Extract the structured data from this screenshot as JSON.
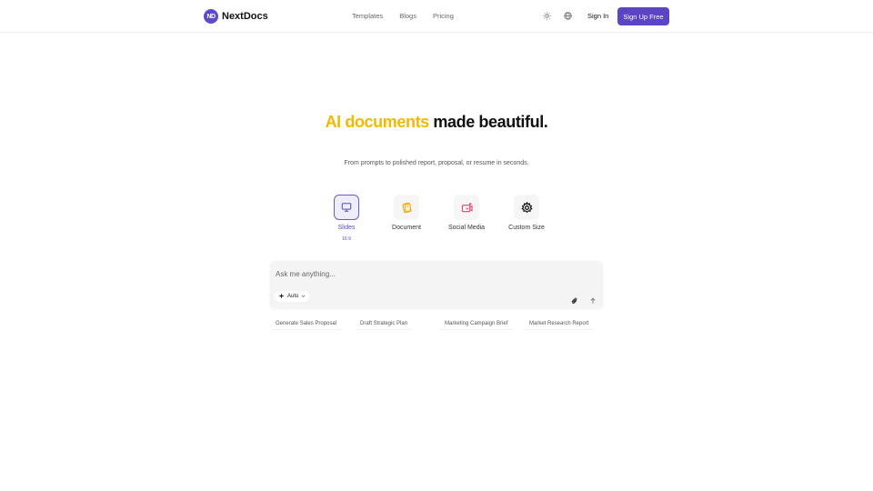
{
  "brand": {
    "mark": "ND",
    "name": "NextDocs",
    "accent": "#5a4bc9"
  },
  "nav": {
    "templates": "Templates",
    "blogs": "Blogs",
    "pricing": "Pricing"
  },
  "actions": {
    "theme_icon": "sun-icon",
    "language_icon": "globe-icon",
    "sign_in": "Sign In",
    "sign_up": "Sign Up Free"
  },
  "hero": {
    "title_accent": "AI documents",
    "title_rest": "made beautiful.",
    "subtitle": "From prompts to polished report, proposal, or resume in seconds.",
    "accent_color": "#f5b800"
  },
  "modes": [
    {
      "label": "Slides",
      "sub": "16:9",
      "icon": "monitor-icon",
      "active": true
    },
    {
      "label": "Document",
      "icon": "document-icon"
    },
    {
      "label": "Social Media",
      "icon": "social-media-icon"
    },
    {
      "label": "Custom Size",
      "icon": "gear-icon"
    }
  ],
  "prompt": {
    "placeholder": "Ask me anything...",
    "mode": "Auto"
  },
  "suggestions": [
    "Generate Sales Proposal",
    "Draft Strategic Plan",
    "Marketing Campaign Brief",
    "Market Research Report"
  ]
}
